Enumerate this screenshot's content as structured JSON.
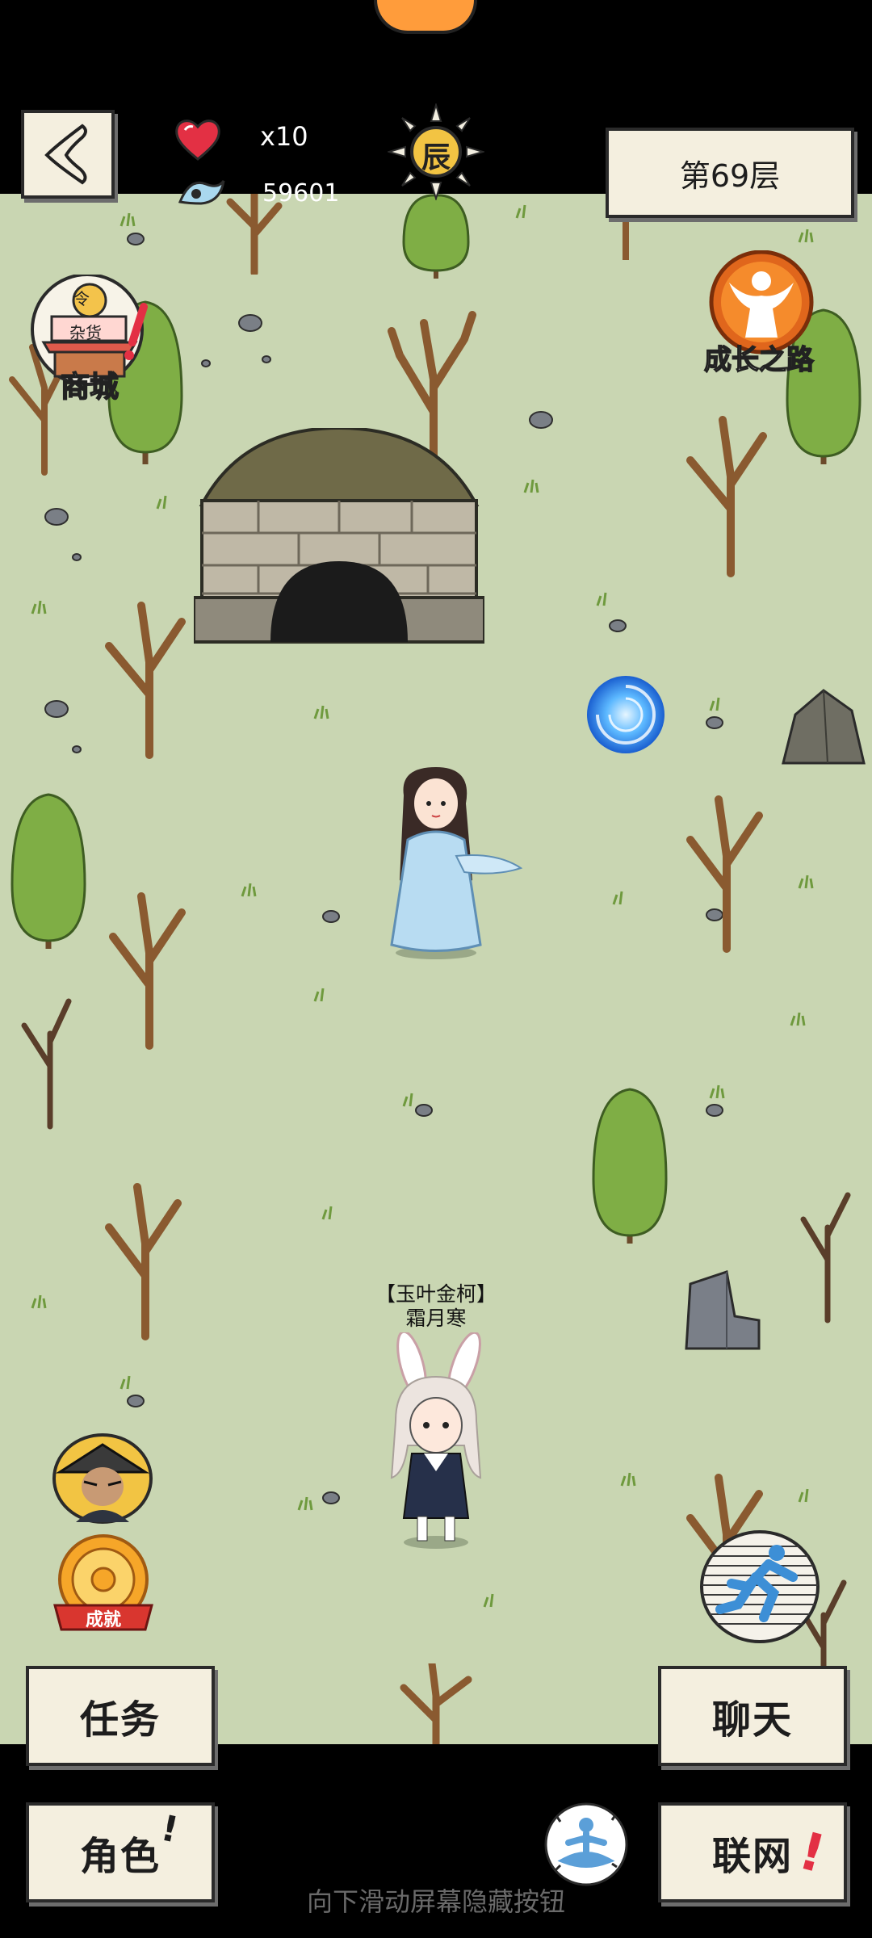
{
  "hud": {
    "lives": "x10",
    "currency": "59601",
    "time_glyph": "辰",
    "floor": "第69层"
  },
  "shortcuts": {
    "shop": "商城",
    "shop_sign": "杂货",
    "shop_top": "令",
    "growth": "成长之路",
    "achievement": "成就"
  },
  "characters": {
    "player_title": "【玉叶金柯】",
    "player_name": "霜月寒"
  },
  "buttons": {
    "tasks": "任务",
    "chat": "聊天",
    "character": "角色",
    "network": "联网",
    "alert": "!"
  },
  "hint": "向下滑动屏幕隐藏按钮",
  "colors": {
    "map_bg": "#c9d6b2",
    "paper": "#f4efdf",
    "accent_red": "#e33044"
  }
}
